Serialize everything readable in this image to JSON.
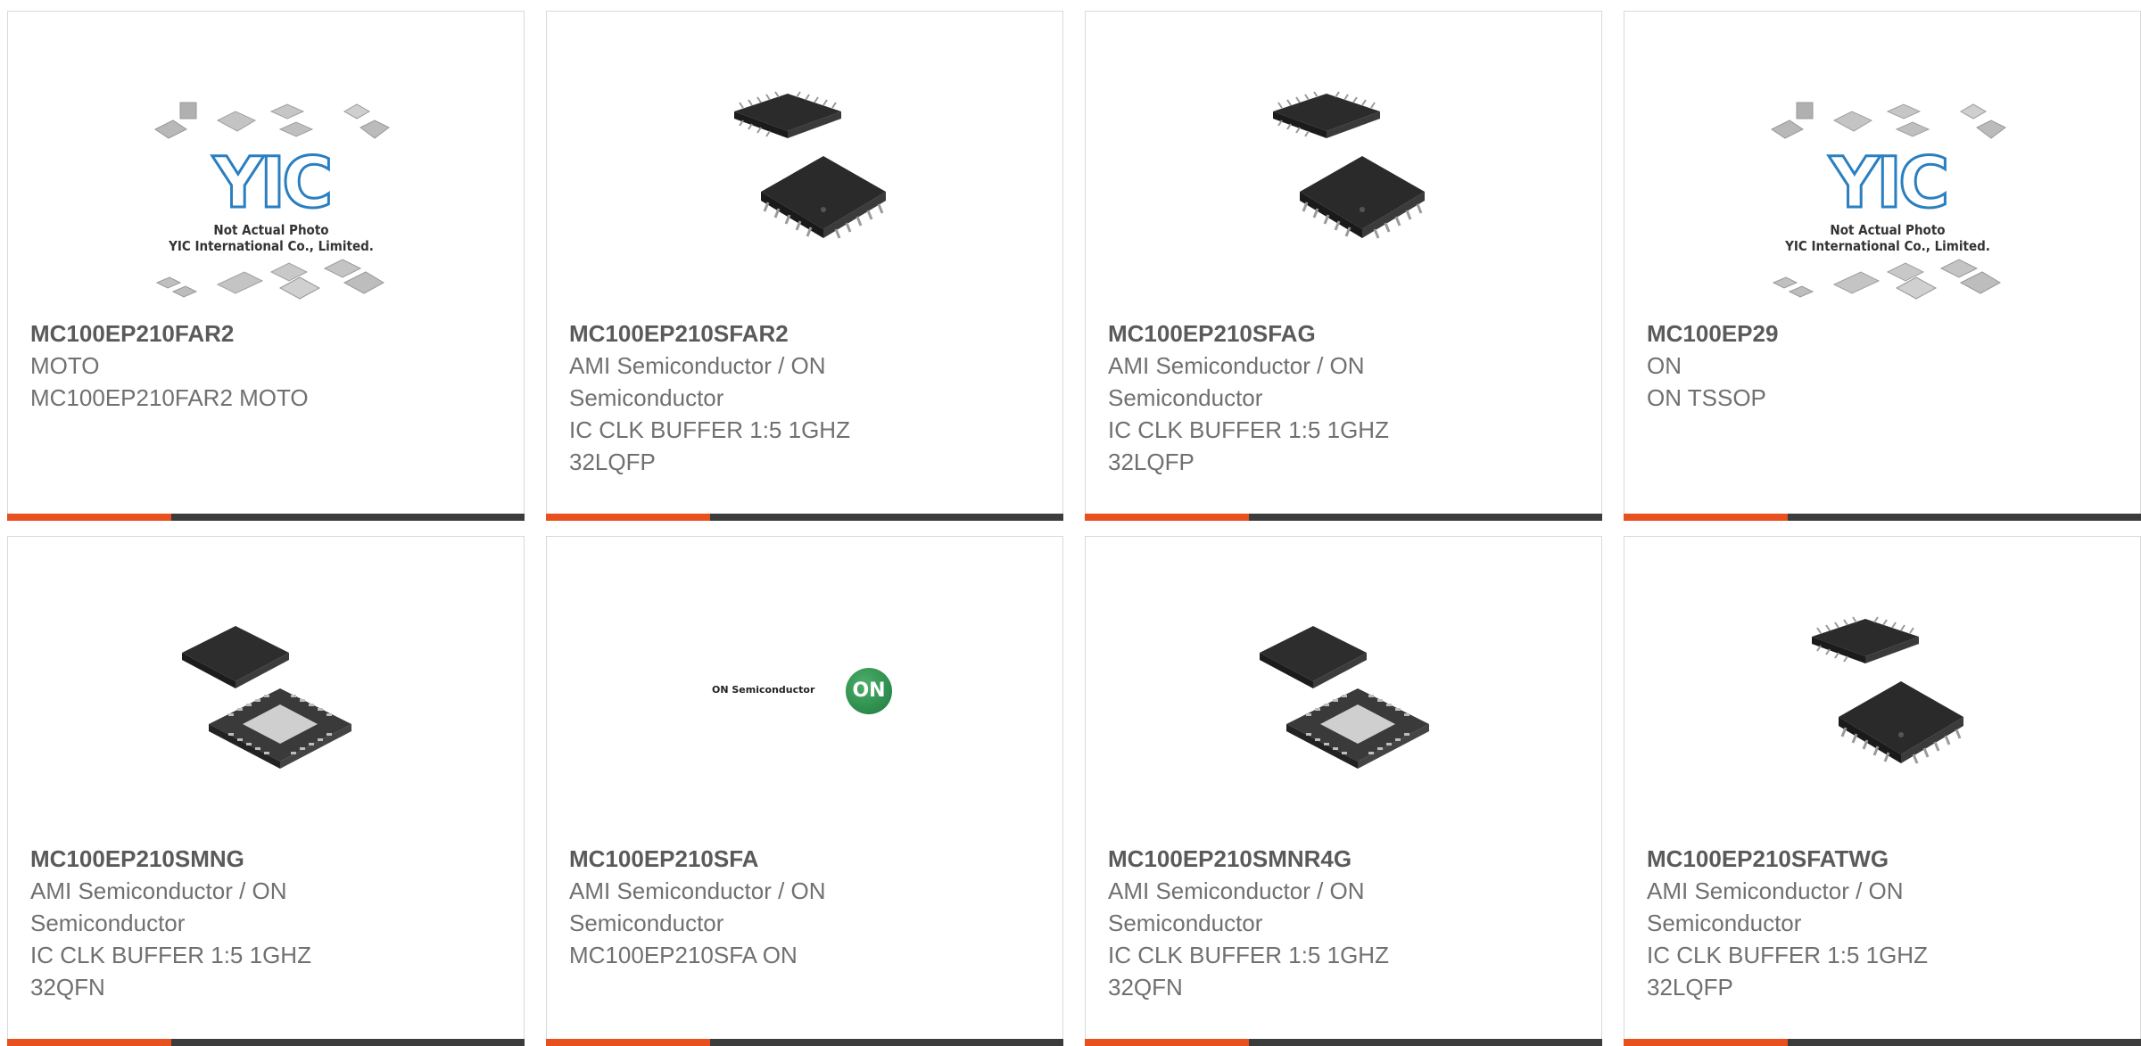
{
  "accent_color": "#e8501e",
  "bar_color": "#3c3c3c",
  "placeholder": {
    "logo_text": "YIC",
    "note_line1": "Not Actual Photo",
    "note_line2": "YIC International Co., Limited."
  },
  "brand_logo": {
    "wordmark": "ON Semiconductor",
    "badge": "ON"
  },
  "products": [
    {
      "part": "MC100EP210FAR2",
      "maker": "MOTO",
      "desc": "MC100EP210FAR2 MOTO",
      "image": "yic-placeholder-icon"
    },
    {
      "part": "MC100EP210SFAR2",
      "maker": "AMI Semiconductor / ON\nSemiconductor",
      "desc": "IC CLK BUFFER 1:5 1GHZ\n32LQFP",
      "image": "lqfp-chip-icon"
    },
    {
      "part": "MC100EP210SFAG",
      "maker": "AMI Semiconductor / ON\nSemiconductor",
      "desc": "IC CLK BUFFER 1:5 1GHZ\n32LQFP",
      "image": "lqfp-chip-icon"
    },
    {
      "part": "MC100EP29",
      "maker": "ON",
      "desc": "ON TSSOP",
      "image": "yic-placeholder-icon"
    },
    {
      "part": "MC100EP210SMNG",
      "maker": "AMI Semiconductor / ON\nSemiconductor",
      "desc": "IC CLK BUFFER 1:5 1GHZ\n32QFN",
      "image": "qfn-chip-icon"
    },
    {
      "part": "MC100EP210SFA",
      "maker": "AMI Semiconductor / ON\nSemiconductor",
      "desc": "MC100EP210SFA ON",
      "image": "on-semiconductor-logo"
    },
    {
      "part": "MC100EP210SMNR4G",
      "maker": "AMI Semiconductor / ON\nSemiconductor",
      "desc": "IC CLK BUFFER 1:5 1GHZ\n32QFN",
      "image": "qfn-chip-icon"
    },
    {
      "part": "MC100EP210SFATWG",
      "maker": "AMI Semiconductor / ON\nSemiconductor",
      "desc": "IC CLK BUFFER 1:5 1GHZ\n32LQFP",
      "image": "lqfp-chip-icon"
    }
  ]
}
